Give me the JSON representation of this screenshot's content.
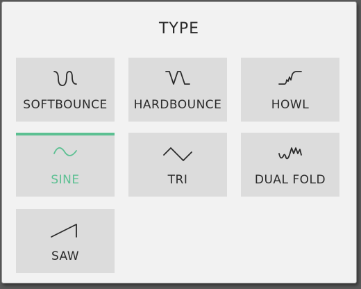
{
  "panel": {
    "title": "TYPE"
  },
  "colors": {
    "accent": "#5cc092",
    "tile": "#dcdcdc",
    "text": "#2a2a2a"
  },
  "types": [
    {
      "label": "SOFTBOUNCE",
      "icon": "softbounce-wave-icon",
      "selected": false
    },
    {
      "label": "HARDBOUNCE",
      "icon": "hardbounce-wave-icon",
      "selected": false
    },
    {
      "label": "HOWL",
      "icon": "howl-wave-icon",
      "selected": false
    },
    {
      "label": "SINE",
      "icon": "sine-wave-icon",
      "selected": true
    },
    {
      "label": "TRI",
      "icon": "triangle-wave-icon",
      "selected": false
    },
    {
      "label": "DUAL FOLD",
      "icon": "dual-fold-wave-icon",
      "selected": false
    },
    {
      "label": "SAW",
      "icon": "saw-wave-icon",
      "selected": false
    }
  ]
}
